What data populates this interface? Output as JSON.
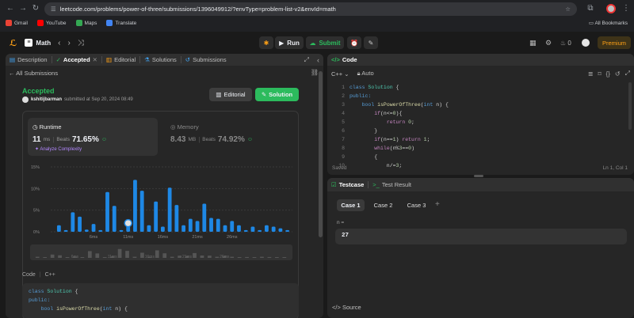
{
  "browser": {
    "url": "leetcode.com/problems/power-of-three/submissions/1396049912/?envType=problem-list-v2&envId=math",
    "bookmarks": [
      {
        "label": "Gmail",
        "color": "#ea4335"
      },
      {
        "label": "YouTube",
        "color": "#ff0000"
      },
      {
        "label": "Maps",
        "color": "#34a853"
      },
      {
        "label": "Translate",
        "color": "#4285f4"
      }
    ],
    "all_bookmarks": "All Bookmarks"
  },
  "nav": {
    "problem_list": "Math",
    "run": "Run",
    "submit": "Submit",
    "coins": "0",
    "premium": "Premium"
  },
  "left": {
    "tabs": [
      {
        "label": "Description"
      },
      {
        "label": "Accepted"
      },
      {
        "label": "Editorial"
      },
      {
        "label": "Solutions"
      },
      {
        "label": "Submissions"
      }
    ],
    "back": "All Submissions",
    "status": "Accepted",
    "user": "kshitijbarman",
    "submitted": "submitted at Sep 20, 2024 08:49",
    "editorial_btn": "Editorial",
    "solution_btn": "Solution",
    "runtime": {
      "label": "Runtime",
      "value": "11",
      "unit": "ms",
      "beats_label": "Beats",
      "beats": "71.65%",
      "analyze": "Analyze Complexity"
    },
    "memory": {
      "label": "Memory",
      "value": "8.43",
      "unit": "MB",
      "beats_label": "Beats",
      "beats": "74.92%"
    },
    "code_label": "Code",
    "lang": "C++",
    "code": [
      "class Solution {",
      "public:",
      "    bool isPowerOfThree(int n) {",
      "        if(n<=0)return"
    ]
  },
  "chart_data": {
    "type": "bar",
    "yticks": [
      "15%",
      "10%",
      "5%",
      "0%"
    ],
    "ylim": [
      0,
      15
    ],
    "xticks": [
      "6ms",
      "11ms",
      "16ms",
      "21ms",
      "26ms"
    ],
    "xtick_index": [
      6,
      11,
      16,
      21,
      26
    ],
    "x": [
      1,
      2,
      3,
      4,
      5,
      6,
      7,
      8,
      9,
      10,
      11,
      12,
      13,
      14,
      15,
      16,
      17,
      18,
      19,
      20,
      21,
      22,
      23,
      24,
      25,
      26,
      27,
      28,
      29,
      30,
      31,
      32,
      33,
      34
    ],
    "values": [
      1.5,
      0.4,
      4.5,
      3.5,
      0.5,
      1.8,
      0.4,
      9.2,
      6.0,
      0.4,
      2.0,
      12.0,
      9.5,
      1.5,
      7.0,
      1.2,
      10.2,
      6.2,
      1.5,
      3.0,
      2.5,
      6.5,
      3.2,
      3.0,
      1.5,
      2.5,
      1.5,
      0.4,
      1.2,
      0.4,
      1.5,
      1.2,
      0.8,
      0.4
    ],
    "highlight_x": 11,
    "colors": {
      "bar": "#1e88e5",
      "bar_dim": "#2b6fb0"
    },
    "minimap_labels": [
      "6ms",
      "11ms",
      "16ms",
      "21ms",
      "26ms"
    ]
  },
  "right": {
    "code_tab": "Code",
    "lang": "C++",
    "auto": "Auto",
    "lines": [
      "1",
      "2",
      "3",
      "4",
      "5",
      "6",
      "7",
      "8",
      "9",
      "10"
    ],
    "saved": "Saved",
    "cursor": "Ln 1, Col 1",
    "testcase_tab": "Testcase",
    "result_tab": "Test Result",
    "cases": [
      "Case 1",
      "Case 2",
      "Case 3"
    ],
    "var": "n =",
    "value": "27",
    "source": "Source"
  }
}
